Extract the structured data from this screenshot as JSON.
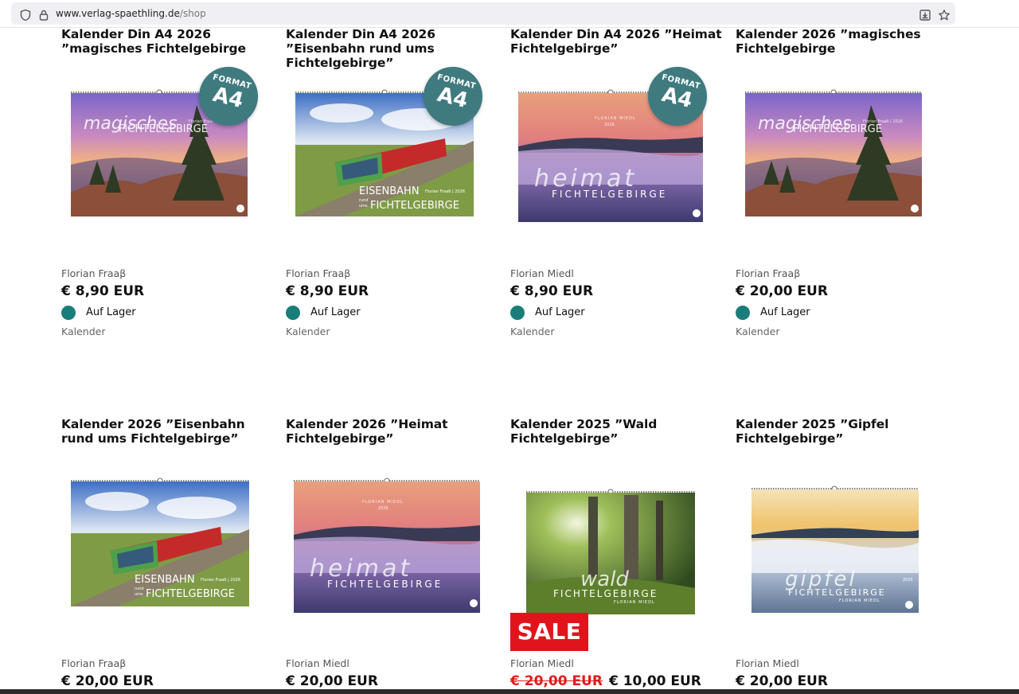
{
  "browser": {
    "url_host": "www.verlag-spaethling.de",
    "url_path": "/shop",
    "icons": [
      "shield-icon",
      "lock-icon",
      "download-icon",
      "star-icon"
    ]
  },
  "products": [
    {
      "title": "Kalender Din A4 2026 ”magisches Fichtelgebirge",
      "author": "Florian Fraaβ",
      "price": "€ 8,90 EUR",
      "stock": "Auf Lager",
      "category": "Kalender",
      "badge_top": "FORMAT",
      "badge_main": "A4",
      "cover_title": "magisches",
      "cover_sub": "FICHTELGEBIRGE",
      "cover_small": "Florian Fraaß | 2026"
    },
    {
      "title": "Kalender Din A4 2026 ”Eisenbahn rund ums Fichtelgebirge”",
      "author": "Florian Fraaβ",
      "price": "€ 8,90 EUR",
      "stock": "Auf Lager",
      "category": "Kalender",
      "badge_top": "FORMAT",
      "badge_main": "A4",
      "cover_title": "EISENBAHN",
      "cover_sub": "FICHTELGEBIRGE",
      "cover_small": "Florian Fraaß | 2026",
      "cover_rund": "rund",
      "cover_ums": "ums"
    },
    {
      "title": "Kalender Din A4 2026 ”Heimat Fichtelgebirge”",
      "author": "Florian Miedl",
      "price": "€ 8,90 EUR",
      "stock": "Auf Lager",
      "category": "Kalender",
      "badge_top": "FORMAT",
      "badge_main": "A4",
      "cover_title": "heimat",
      "cover_sub": "FICHTELGEBIRGE",
      "cover_small": "FLORIAN MIEDL",
      "cover_year": "2026"
    },
    {
      "title": "Kalender 2026 ”magisches Fichtelgebirge",
      "author": "Florian Fraaβ",
      "price": "€ 20,00 EUR",
      "stock": "Auf Lager",
      "category": "Kalender",
      "cover_title": "magisches",
      "cover_sub": "FICHTELGEBIRGE",
      "cover_small": "Florian Fraaß | 2026"
    },
    {
      "title": "Kalender 2026 ”Eisenbahn rund ums Fichtelgebirge”",
      "author": "Florian Fraaβ",
      "price": "€ 20,00 EUR",
      "cover_title": "EISENBAHN",
      "cover_sub": "FICHTELGEBIRGE",
      "cover_small": "Florian Fraaß | 2026",
      "cover_rund": "rund",
      "cover_ums": "ums"
    },
    {
      "title": "Kalender 2026 ”Heimat Fichtelgebirge”",
      "author": "Florian Miedl",
      "price": "€ 20,00 EUR",
      "cover_title": "heimat",
      "cover_sub": "FICHTELGEBIRGE",
      "cover_small": "FLORIAN MIEDL",
      "cover_year": "2026"
    },
    {
      "title": "Kalender 2025 ”Wald Fichtelgebirge”",
      "author": "Florian Miedl",
      "old_price": "€ 20,00 EUR",
      "price": "€ 10,00 EUR",
      "sale": "SALE",
      "cover_title": "wald",
      "cover_sub": "FICHTELGEBIRGE",
      "cover_small": "FLORIAN MIEDL"
    },
    {
      "title": "Kalender 2025 ”Gipfel Fichtelgebirge”",
      "author": "Florian Miedl",
      "price": "€ 20,00 EUR",
      "cover_title": "gipfel",
      "cover_sub": "FICHTELGEBIRGE",
      "cover_small": "FLORIAN MIEDL",
      "cover_year": "2025"
    }
  ],
  "colors": {
    "stock_dot": "#1b7d7a",
    "badge": "#3f7a7f",
    "sale": "#e2141b",
    "old_price": "#e11b1b"
  }
}
